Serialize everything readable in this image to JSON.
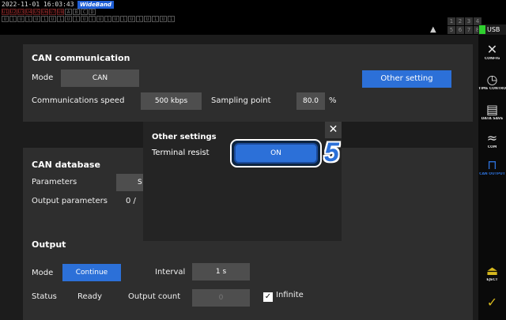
{
  "status_bar": {
    "datetime": "2022-11-01 16:03:43",
    "bandwidth_badge": "WideBand",
    "indicator_row1": [
      "U1",
      "U2",
      "U3",
      "U4",
      "U5",
      "U6",
      "U7",
      "U8",
      "A",
      "B",
      "C",
      "D"
    ],
    "indicator_row2": [
      "U",
      "1",
      "U",
      "1",
      "U",
      "1",
      "U",
      "1",
      "U",
      "1",
      "U",
      "1",
      "U",
      "1",
      "U",
      "1",
      "U",
      "1",
      "U",
      "1",
      "U",
      "1"
    ],
    "channels_row1": [
      "1",
      "2",
      "3",
      "4"
    ],
    "channels_row2": [
      "5",
      "6",
      "7",
      "8"
    ],
    "usb_label": "USB"
  },
  "can_communication": {
    "title": "CAN communication",
    "mode_label": "Mode",
    "mode_value": "CAN",
    "other_setting_button": "Other setting",
    "speed_label": "Communications speed",
    "speed_value": "500 kbps",
    "sampling_label": "Sampling point",
    "sampling_value": "80.0",
    "sampling_unit": "%"
  },
  "can_database": {
    "title": "CAN database",
    "parameters_label": "Parameters",
    "parameters_value": "S",
    "output_parameters_label": "Output parameters",
    "output_parameters_value": "0 /"
  },
  "output": {
    "title": "Output",
    "mode_label": "Mode",
    "mode_value": "Continue",
    "interval_label": "Interval",
    "interval_value": "1 s",
    "status_label": "Status",
    "status_value": "Ready",
    "output_count_label": "Output count",
    "output_count_value": "0",
    "infinite_label": "Infinite",
    "infinite_checked": true
  },
  "modal": {
    "title": "Other settings",
    "terminal_label": "Terminal resist",
    "terminal_value": "ON",
    "close_icon": "close-icon",
    "step_number": "5"
  },
  "side_menu": {
    "config": "CONFIG",
    "time_control": "TIME CONTROL",
    "data_save": "DATA SAVE",
    "com": "COM",
    "can_output": "CAN OUTPUT",
    "eject": "EJECT"
  },
  "colors": {
    "accent": "#2c70d8",
    "panel": "#2e2e2e",
    "background": "#1c1c1c",
    "usb_led": "#2fcf2f"
  }
}
